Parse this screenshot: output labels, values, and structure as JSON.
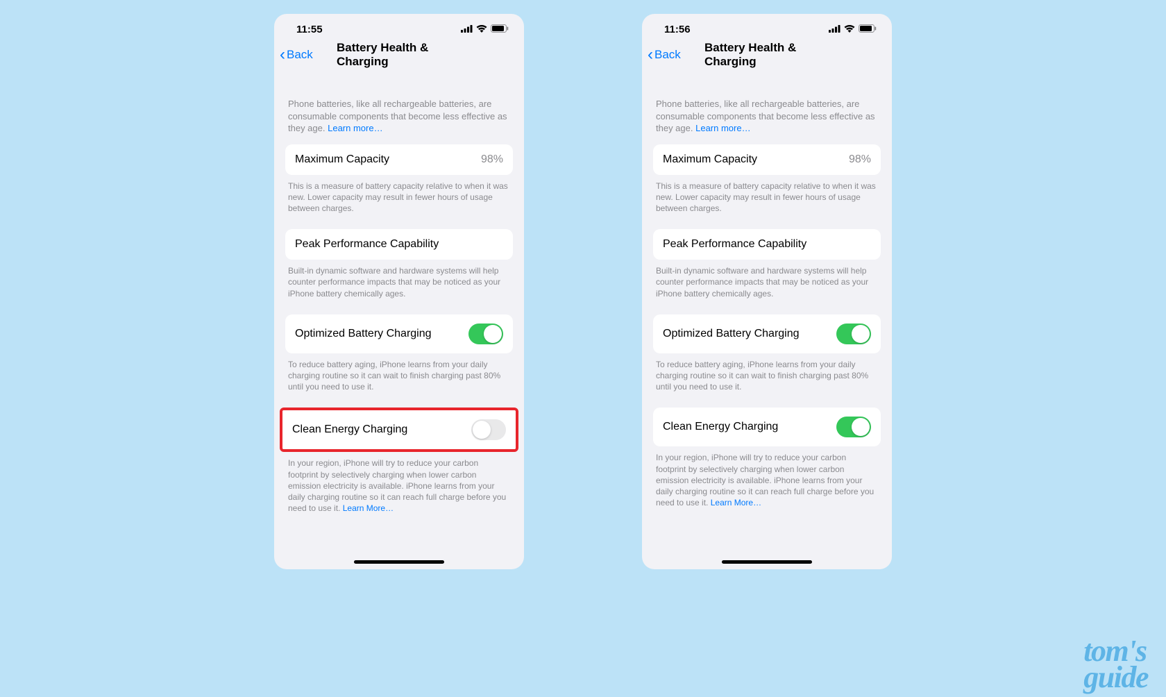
{
  "phones": [
    {
      "status": {
        "time": "11:55"
      },
      "nav": {
        "back_label": "Back",
        "title": "Battery Health & Charging"
      },
      "intro": {
        "text": "Phone batteries, like all rechargeable batteries, are consumable components that become less effective as they age. ",
        "link": "Learn more…"
      },
      "capacity": {
        "label": "Maximum Capacity",
        "value": "98%",
        "footer": "This is a measure of battery capacity relative to when it was new. Lower capacity may result in fewer hours of usage between charges."
      },
      "performance": {
        "label": "Peak Performance Capability",
        "footer": "Built-in dynamic software and hardware systems will help counter performance impacts that may be noticed as your iPhone battery chemically ages."
      },
      "optimized": {
        "label": "Optimized Battery Charging",
        "on": true,
        "footer": "To reduce battery aging, iPhone learns from your daily charging routine so it can wait to finish charging past 80% until you need to use it."
      },
      "clean": {
        "label": "Clean Energy Charging",
        "on": false,
        "highlight": true,
        "footer": "In your region, iPhone will try to reduce your carbon footprint by selectively charging when lower carbon emission electricity is available. iPhone learns from your daily charging routine so it can reach full charge before you need to use it. ",
        "link": "Learn More…"
      }
    },
    {
      "status": {
        "time": "11:56"
      },
      "nav": {
        "back_label": "Back",
        "title": "Battery Health & Charging"
      },
      "intro": {
        "text": "Phone batteries, like all rechargeable batteries, are consumable components that become less effective as they age. ",
        "link": "Learn more…"
      },
      "capacity": {
        "label": "Maximum Capacity",
        "value": "98%",
        "footer": "This is a measure of battery capacity relative to when it was new. Lower capacity may result in fewer hours of usage between charges."
      },
      "performance": {
        "label": "Peak Performance Capability",
        "footer": "Built-in dynamic software and hardware systems will help counter performance impacts that may be noticed as your iPhone battery chemically ages."
      },
      "optimized": {
        "label": "Optimized Battery Charging",
        "on": true,
        "footer": "To reduce battery aging, iPhone learns from your daily charging routine so it can wait to finish charging past 80% until you need to use it."
      },
      "clean": {
        "label": "Clean Energy Charging",
        "on": true,
        "highlight": false,
        "footer": "In your region, iPhone will try to reduce your carbon footprint by selectively charging when lower carbon emission electricity is available. iPhone learns from your daily charging routine so it can reach full charge before you need to use it. ",
        "link": "Learn More…"
      }
    }
  ],
  "watermark": {
    "line1": "tom's",
    "line2": "guide"
  }
}
